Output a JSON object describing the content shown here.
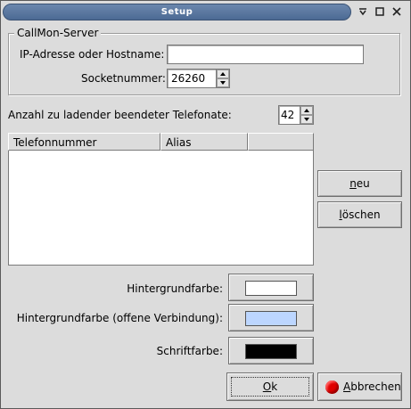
{
  "window": {
    "title": "Setup"
  },
  "titlebar_buttons": [
    {
      "name": "minimize",
      "icon": "minimize-icon"
    },
    {
      "name": "maximize",
      "icon": "maximize-icon"
    },
    {
      "name": "close",
      "icon": "close-icon"
    }
  ],
  "server_group": {
    "label": "CallMon-Server",
    "host_label": "IP-Adresse oder Hostname:",
    "host_value": "",
    "socket_label": "Socketnummer:",
    "socket_value": "26260"
  },
  "calls": {
    "label": "Anzahl zu ladender beendeter Telefonate:",
    "value": "42"
  },
  "table": {
    "columns": [
      "Telefonnummer",
      "Alias",
      ""
    ],
    "rows": []
  },
  "buttons": {
    "new_prefix": "",
    "new_accel": "n",
    "new_rest": "eu",
    "delete_prefix": "",
    "delete_accel": "l",
    "delete_rest": "öschen",
    "ok_accel": "O",
    "ok_rest": "k",
    "cancel_accel": "A",
    "cancel_rest": "bbrechen"
  },
  "colors": {
    "background_label": "Hintergrundfarbe:",
    "background_color": "#ffffff",
    "open_conn_label": "Hintergrundfarbe (offene Verbindung):",
    "open_conn_color": "#bcd6ff",
    "font_label": "Schriftfarbe:",
    "font_color": "#000000",
    "cancel_icon_color": "#e00000"
  }
}
